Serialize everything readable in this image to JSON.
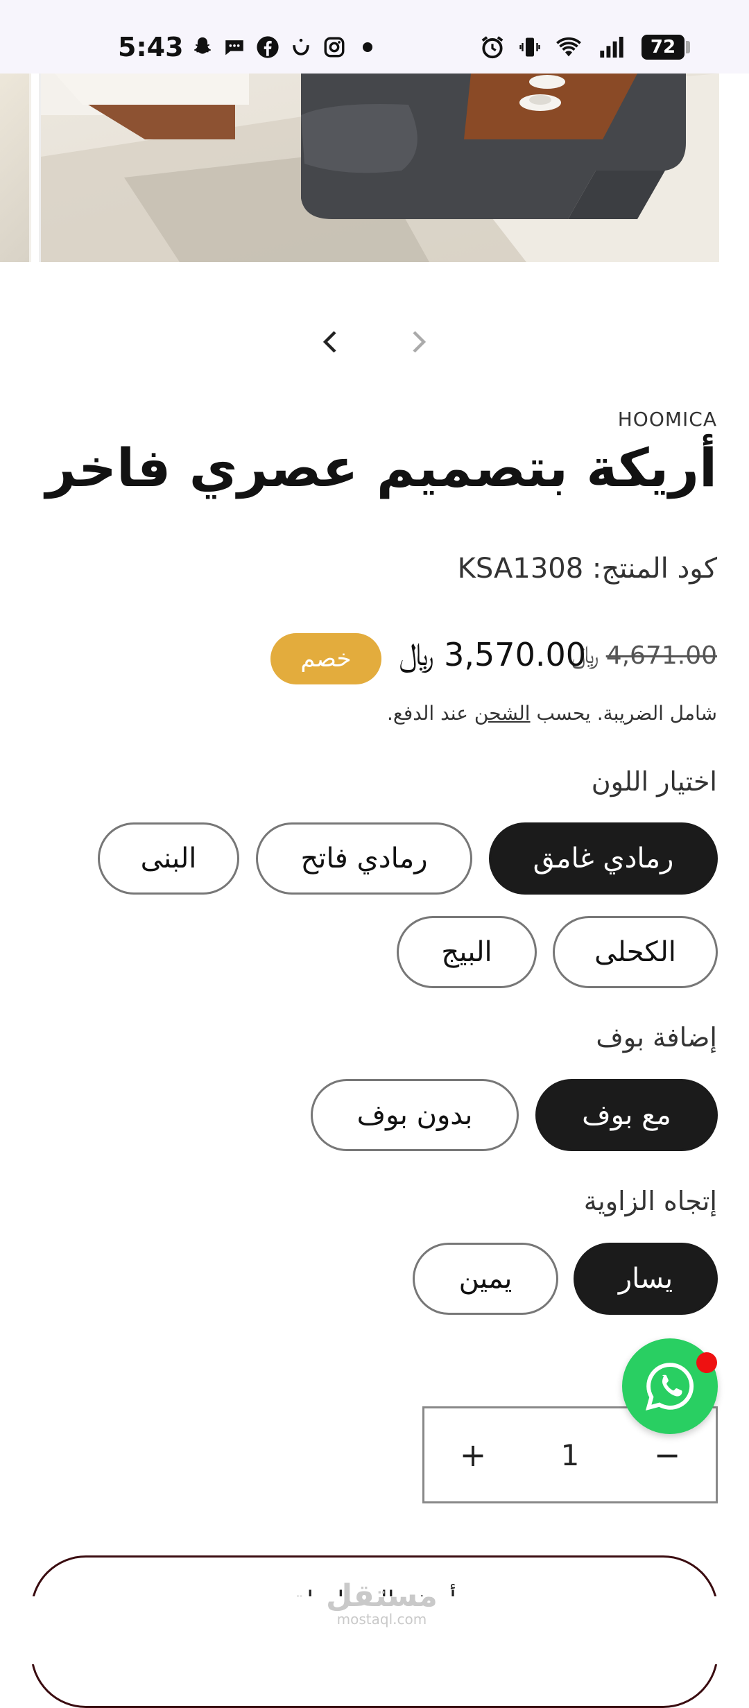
{
  "status_bar": {
    "time": "5:43",
    "battery": "72",
    "icons": [
      "snapchat-icon",
      "messages-icon",
      "facebook-icon",
      "notification-n-icon",
      "instagram-icon",
      "dot-icon",
      "alarm-icon",
      "vibrate-icon",
      "wifi-icon",
      "signal-icon",
      "battery-icon"
    ]
  },
  "product": {
    "brand": "HOOMICA",
    "title": "أريكة بتصميم عصري فاخر",
    "code_label": "كود المنتج:",
    "code": "KSA1308",
    "old_price": "4,671.00",
    "new_price": "3,570.00",
    "currency_symbol": "﷼",
    "sale_badge": "خصم",
    "tax_note_before": "شامل الضريبة. يحسب",
    "tax_note_link": "الشحن",
    "tax_note_after": "عند الدفع."
  },
  "options": {
    "color": {
      "label": "اختيار اللون",
      "values": [
        "رمادي غامق",
        "رمادي فاتح",
        "البنى",
        "الكحلى",
        "البيج"
      ],
      "selected": "رمادي غامق"
    },
    "pouf": {
      "label": "إضافة بوف",
      "values": [
        "مع بوف",
        "بدون بوف"
      ],
      "selected": "مع بوف"
    },
    "corner": {
      "label": "إتجاه الزاوية",
      "values": [
        "يسار",
        "يمين"
      ],
      "selected": "يسار"
    }
  },
  "quantity": {
    "value": "1",
    "minus": "−",
    "plus": "+"
  },
  "cart": {
    "label": "أضف إلى السلة"
  },
  "watermark": {
    "main": "مستقل",
    "sub": "mostaql.com"
  },
  "colors": {
    "accent": "#e3ac3d",
    "selected": "#1b1b1b",
    "whatsapp": "#29cf62",
    "cart_border": "#3a0c10"
  }
}
